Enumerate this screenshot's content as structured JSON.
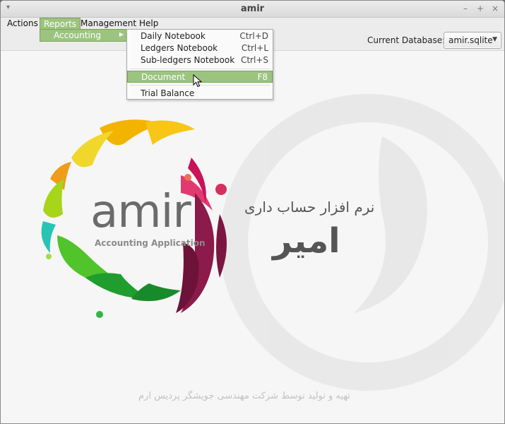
{
  "window": {
    "title": "amir"
  },
  "menubar": {
    "items": [
      {
        "label": "Actions",
        "active": false
      },
      {
        "label": "Reports",
        "active": true
      },
      {
        "label": "Management",
        "active": false
      },
      {
        "label": "Help",
        "active": false
      }
    ]
  },
  "submenu": {
    "label": "Accounting"
  },
  "dropdown": {
    "items": [
      {
        "label": "Daily Notebook",
        "accel": "Ctrl+D"
      },
      {
        "label": "Ledgers Notebook",
        "accel": "Ctrl+L"
      },
      {
        "label": "Sub-ledgers Notebook",
        "accel": "Ctrl+S"
      },
      {
        "label": "Document",
        "accel": "F8",
        "active": true
      },
      {
        "label": "Trial Balance",
        "accel": ""
      }
    ]
  },
  "toolbar": {
    "db_label": "Current Database:",
    "db_value": "amir.sqlite"
  },
  "content": {
    "logo_word": "amir",
    "logo_tagline": "Accounting Application",
    "fa_tagline": "نرم افزار حساب داری",
    "fa_name": "امیر",
    "footer": "تهیه و تولید توسط شرکت مهندسی جویشگر پردیس ارم"
  },
  "colors": {
    "accent": "#9cc47f",
    "accent_border": "#7aa35a"
  }
}
